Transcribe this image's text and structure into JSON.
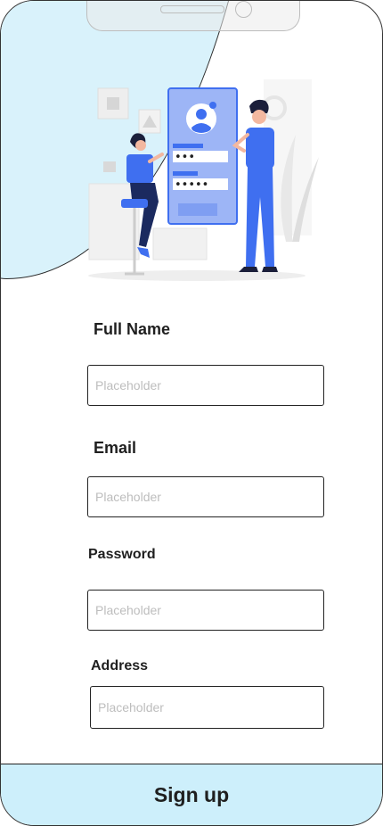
{
  "form": {
    "full_name": {
      "label": "Full Name",
      "placeholder": "Placeholder"
    },
    "email": {
      "label": "Email",
      "placeholder": "Placeholder"
    },
    "password": {
      "label": "Password",
      "placeholder": "Placeholder"
    },
    "address": {
      "label": "Address",
      "placeholder": "Placeholder"
    }
  },
  "signup_button": {
    "label": "Sign up"
  },
  "illustration": {
    "name": "signup-illustration",
    "password_mask_1": "•••",
    "password_mask_2": "•••••"
  },
  "colors": {
    "header_blob": "#d9f2fb",
    "signup_bar": "#cdeffb",
    "accent_blue": "#3f6ff0",
    "border": "#222222",
    "placeholder": "#bdbdbd"
  }
}
